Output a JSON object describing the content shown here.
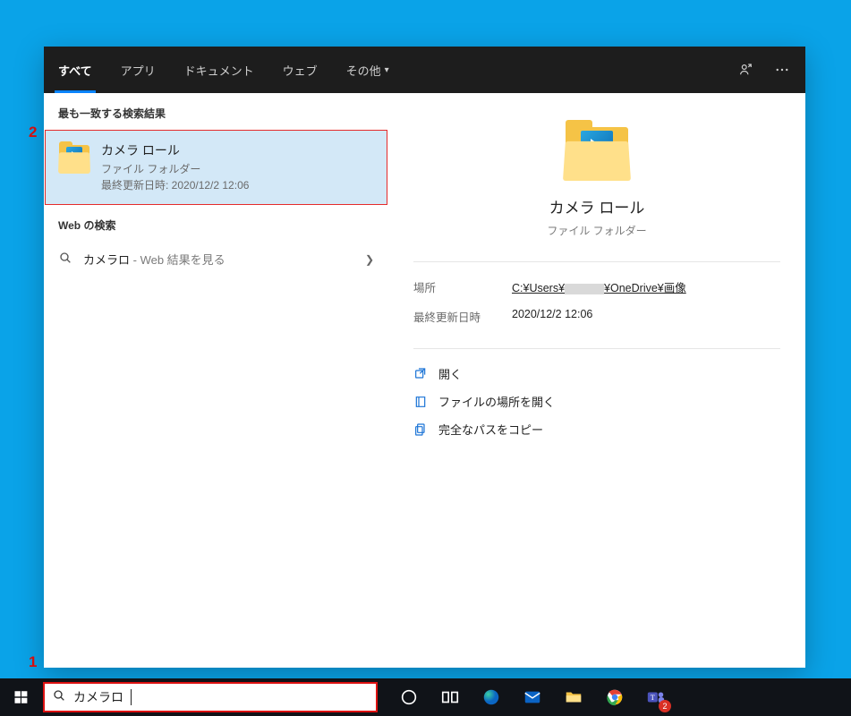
{
  "header": {
    "tabs": [
      {
        "label": "すべて",
        "active": true
      },
      {
        "label": "アプリ"
      },
      {
        "label": "ドキュメント"
      },
      {
        "label": "ウェブ"
      },
      {
        "label": "その他",
        "dropdown": true
      }
    ]
  },
  "left": {
    "best_header": "最も一致する検索結果",
    "best": {
      "title": "カメラ ロール",
      "subtitle": "ファイル フォルダー",
      "updated": "最終更新日時: 2020/12/2 12:06"
    },
    "web_header": "Web の検索",
    "web": {
      "query": "カメラロ",
      "hint": " - Web 結果を見る"
    }
  },
  "right": {
    "title": "カメラ ロール",
    "subtitle": "ファイル フォルダー",
    "meta": [
      {
        "label": "場所",
        "value_prefix": "C:¥Users¥",
        "value_suffix": "¥OneDrive¥画像",
        "redacted": true,
        "link": true
      },
      {
        "label": "最終更新日時",
        "value": "2020/12/2 12:06"
      }
    ],
    "actions": [
      {
        "icon": "open-icon",
        "label": "開く"
      },
      {
        "icon": "open-location-icon",
        "label": "ファイルの場所を開く"
      },
      {
        "icon": "copy-path-icon",
        "label": "完全なパスをコピー"
      }
    ]
  },
  "taskbar": {
    "search_value": "カメラロ",
    "teams_badge": "2"
  },
  "annotations": {
    "a1": "1",
    "a2": "2"
  }
}
